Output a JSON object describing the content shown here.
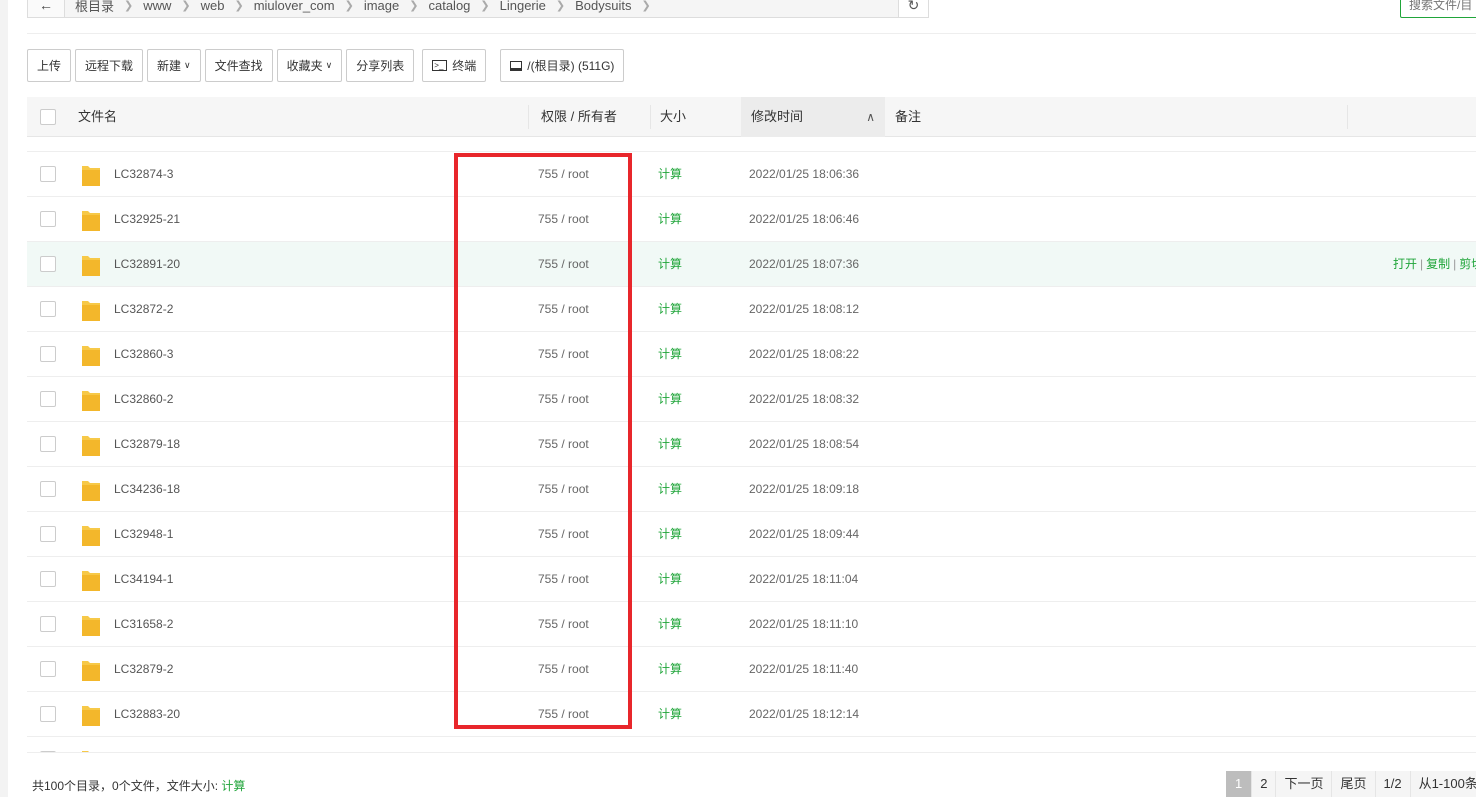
{
  "path": {
    "back_icon": "arrow-left-icon",
    "crumbs": [
      "根目录",
      "www",
      "web",
      "miulover_com",
      "image",
      "catalog",
      "Lingerie",
      "Bodysuits"
    ],
    "refresh_icon": "refresh-icon"
  },
  "search": {
    "placeholder": "搜索文件/目"
  },
  "toolbar": {
    "upload": "上传",
    "remote_download": "远程下载",
    "new": "新建",
    "find_file": "文件查找",
    "favorites": "收藏夹",
    "share_list": "分享列表",
    "terminal": "终端",
    "disk": "/(根目录) (511G)"
  },
  "table": {
    "headers": {
      "name": "文件名",
      "perm": "权限 / 所有者",
      "size": "大小",
      "mtime": "修改时间",
      "remark": "备注"
    },
    "rows": [
      {
        "name": "LC32874-3",
        "perm": "755 / root",
        "size": "计算",
        "mtime": "2022/01/25 18:06:36"
      },
      {
        "name": "LC32925-21",
        "perm": "755 / root",
        "size": "计算",
        "mtime": "2022/01/25 18:06:46"
      },
      {
        "name": "LC32891-20",
        "perm": "755 / root",
        "size": "计算",
        "mtime": "2022/01/25 18:07:36"
      },
      {
        "name": "LC32872-2",
        "perm": "755 / root",
        "size": "计算",
        "mtime": "2022/01/25 18:08:12"
      },
      {
        "name": "LC32860-3",
        "perm": "755 / root",
        "size": "计算",
        "mtime": "2022/01/25 18:08:22"
      },
      {
        "name": "LC32860-2",
        "perm": "755 / root",
        "size": "计算",
        "mtime": "2022/01/25 18:08:32"
      },
      {
        "name": "LC32879-18",
        "perm": "755 / root",
        "size": "计算",
        "mtime": "2022/01/25 18:08:54"
      },
      {
        "name": "LC34236-18",
        "perm": "755 / root",
        "size": "计算",
        "mtime": "2022/01/25 18:09:18"
      },
      {
        "name": "LC32948-1",
        "perm": "755 / root",
        "size": "计算",
        "mtime": "2022/01/25 18:09:44"
      },
      {
        "name": "LC34194-1",
        "perm": "755 / root",
        "size": "计算",
        "mtime": "2022/01/25 18:11:04"
      },
      {
        "name": "LC31658-2",
        "perm": "755 / root",
        "size": "计算",
        "mtime": "2022/01/25 18:11:10"
      },
      {
        "name": "LC32879-2",
        "perm": "755 / root",
        "size": "计算",
        "mtime": "2022/01/25 18:11:40"
      },
      {
        "name": "LC32883-20",
        "perm": "755 / root",
        "size": "计算",
        "mtime": "2022/01/25 18:12:14"
      }
    ],
    "hover_ops": {
      "open": "打开",
      "copy": "复制",
      "cut": "剪切"
    }
  },
  "footer": {
    "summary": "共100个目录，0个文件，文件大小:",
    "calc": "计算"
  },
  "pager": {
    "page1": "1",
    "page2": "2",
    "next": "下一页",
    "last": "尾页",
    "ratio": "1/2",
    "range": "从1-100条"
  },
  "colors": {
    "accent": "#20a53a",
    "highlight": "#e8262b",
    "folder": "#f7c948"
  }
}
